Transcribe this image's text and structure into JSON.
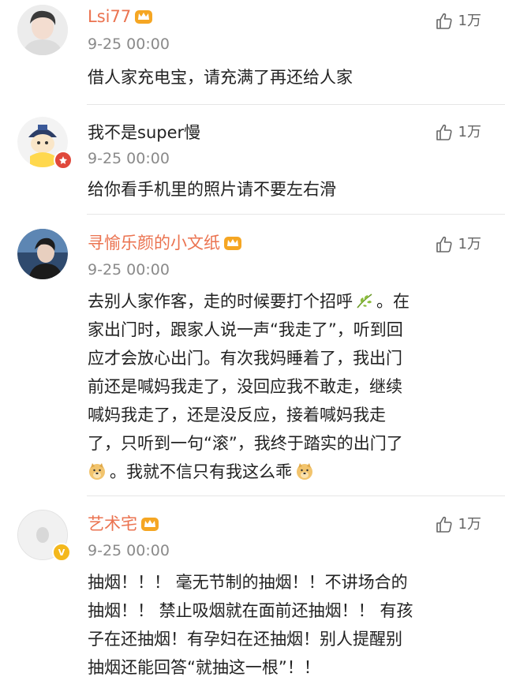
{
  "like_label": "1万",
  "comments": [
    {
      "username": "Lsi77",
      "time": "9-25 00:00",
      "lines": [
        "借人家充电宝，请充满了再还给人家"
      ]
    },
    {
      "username": "我不是super慢",
      "time": "9-25 00:00",
      "lines": [
        "给你看手机里的照片请不要左右滑"
      ]
    },
    {
      "username": "寻愉乐颜的小文纸",
      "time": "9-25 00:00",
      "lines": [
        "去别人家作客，走的时候要打个招呼",
        "。在",
        "家出门时，跟家人说一声“我走了”，听到回",
        "应才会放心出门。有次我妈睡着了，我出门",
        "前还是喊妈我走了，没回应我不敢走，继续",
        "喊妈我走了，还是没反应，接着喊妈我走",
        "了，只听到一句“滚”，我终于踏实的出门了",
        "。我就不信只有我这么乖"
      ]
    },
    {
      "username": "艺术宅",
      "time": "9-25 00:00",
      "lines": [
        "抽烟！！！ 毫无节制的抽烟！！不讲场合的",
        "抽烟！！ 禁止吸烟就在面前还抽烟！！ 有孩",
        "子在还抽烟！有孕妇在还抽烟！别人提醒别",
        "抽烟还能回答“就抽这一根”！！"
      ]
    }
  ],
  "colors": {
    "vip_name": "#eb7350",
    "normal_name": "#222222",
    "meta": "#8a8a8a",
    "divider": "#e6e6e6",
    "crown": "#f5a623",
    "verified_badge": "#f4b81c",
    "red_badge": "#e0483b"
  },
  "icons": [
    "thumbs-up-icon",
    "vip-crown-icon",
    "leaf-emoji-icon",
    "doge-emoji-icon",
    "verified-badge-icon"
  ]
}
